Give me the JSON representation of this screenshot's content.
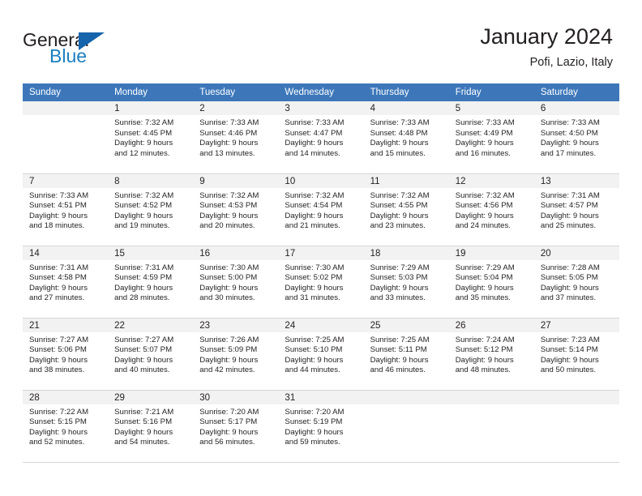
{
  "brand": {
    "name_part1": "General",
    "name_part2": "Blue",
    "triangle_color": "#1664ab",
    "blue_text_color": "#1a7fc1"
  },
  "header": {
    "month_title": "January 2024",
    "location": "Pofi, Lazio, Italy",
    "header_bg_color": "#3d77ba",
    "daynum_band_color": "#f2f2f2"
  },
  "weekday_headers": [
    "Sunday",
    "Monday",
    "Tuesday",
    "Wednesday",
    "Thursday",
    "Friday",
    "Saturday"
  ],
  "weeks": [
    [
      {
        "day": "",
        "sunrise": "",
        "sunset": "",
        "daylight_line1": "",
        "daylight_line2": ""
      },
      {
        "day": "1",
        "sunrise": "Sunrise: 7:32 AM",
        "sunset": "Sunset: 4:45 PM",
        "daylight_line1": "Daylight: 9 hours",
        "daylight_line2": "and 12 minutes."
      },
      {
        "day": "2",
        "sunrise": "Sunrise: 7:33 AM",
        "sunset": "Sunset: 4:46 PM",
        "daylight_line1": "Daylight: 9 hours",
        "daylight_line2": "and 13 minutes."
      },
      {
        "day": "3",
        "sunrise": "Sunrise: 7:33 AM",
        "sunset": "Sunset: 4:47 PM",
        "daylight_line1": "Daylight: 9 hours",
        "daylight_line2": "and 14 minutes."
      },
      {
        "day": "4",
        "sunrise": "Sunrise: 7:33 AM",
        "sunset": "Sunset: 4:48 PM",
        "daylight_line1": "Daylight: 9 hours",
        "daylight_line2": "and 15 minutes."
      },
      {
        "day": "5",
        "sunrise": "Sunrise: 7:33 AM",
        "sunset": "Sunset: 4:49 PM",
        "daylight_line1": "Daylight: 9 hours",
        "daylight_line2": "and 16 minutes."
      },
      {
        "day": "6",
        "sunrise": "Sunrise: 7:33 AM",
        "sunset": "Sunset: 4:50 PM",
        "daylight_line1": "Daylight: 9 hours",
        "daylight_line2": "and 17 minutes."
      }
    ],
    [
      {
        "day": "7",
        "sunrise": "Sunrise: 7:33 AM",
        "sunset": "Sunset: 4:51 PM",
        "daylight_line1": "Daylight: 9 hours",
        "daylight_line2": "and 18 minutes."
      },
      {
        "day": "8",
        "sunrise": "Sunrise: 7:32 AM",
        "sunset": "Sunset: 4:52 PM",
        "daylight_line1": "Daylight: 9 hours",
        "daylight_line2": "and 19 minutes."
      },
      {
        "day": "9",
        "sunrise": "Sunrise: 7:32 AM",
        "sunset": "Sunset: 4:53 PM",
        "daylight_line1": "Daylight: 9 hours",
        "daylight_line2": "and 20 minutes."
      },
      {
        "day": "10",
        "sunrise": "Sunrise: 7:32 AM",
        "sunset": "Sunset: 4:54 PM",
        "daylight_line1": "Daylight: 9 hours",
        "daylight_line2": "and 21 minutes."
      },
      {
        "day": "11",
        "sunrise": "Sunrise: 7:32 AM",
        "sunset": "Sunset: 4:55 PM",
        "daylight_line1": "Daylight: 9 hours",
        "daylight_line2": "and 23 minutes."
      },
      {
        "day": "12",
        "sunrise": "Sunrise: 7:32 AM",
        "sunset": "Sunset: 4:56 PM",
        "daylight_line1": "Daylight: 9 hours",
        "daylight_line2": "and 24 minutes."
      },
      {
        "day": "13",
        "sunrise": "Sunrise: 7:31 AM",
        "sunset": "Sunset: 4:57 PM",
        "daylight_line1": "Daylight: 9 hours",
        "daylight_line2": "and 25 minutes."
      }
    ],
    [
      {
        "day": "14",
        "sunrise": "Sunrise: 7:31 AM",
        "sunset": "Sunset: 4:58 PM",
        "daylight_line1": "Daylight: 9 hours",
        "daylight_line2": "and 27 minutes."
      },
      {
        "day": "15",
        "sunrise": "Sunrise: 7:31 AM",
        "sunset": "Sunset: 4:59 PM",
        "daylight_line1": "Daylight: 9 hours",
        "daylight_line2": "and 28 minutes."
      },
      {
        "day": "16",
        "sunrise": "Sunrise: 7:30 AM",
        "sunset": "Sunset: 5:00 PM",
        "daylight_line1": "Daylight: 9 hours",
        "daylight_line2": "and 30 minutes."
      },
      {
        "day": "17",
        "sunrise": "Sunrise: 7:30 AM",
        "sunset": "Sunset: 5:02 PM",
        "daylight_line1": "Daylight: 9 hours",
        "daylight_line2": "and 31 minutes."
      },
      {
        "day": "18",
        "sunrise": "Sunrise: 7:29 AM",
        "sunset": "Sunset: 5:03 PM",
        "daylight_line1": "Daylight: 9 hours",
        "daylight_line2": "and 33 minutes."
      },
      {
        "day": "19",
        "sunrise": "Sunrise: 7:29 AM",
        "sunset": "Sunset: 5:04 PM",
        "daylight_line1": "Daylight: 9 hours",
        "daylight_line2": "and 35 minutes."
      },
      {
        "day": "20",
        "sunrise": "Sunrise: 7:28 AM",
        "sunset": "Sunset: 5:05 PM",
        "daylight_line1": "Daylight: 9 hours",
        "daylight_line2": "and 37 minutes."
      }
    ],
    [
      {
        "day": "21",
        "sunrise": "Sunrise: 7:27 AM",
        "sunset": "Sunset: 5:06 PM",
        "daylight_line1": "Daylight: 9 hours",
        "daylight_line2": "and 38 minutes."
      },
      {
        "day": "22",
        "sunrise": "Sunrise: 7:27 AM",
        "sunset": "Sunset: 5:07 PM",
        "daylight_line1": "Daylight: 9 hours",
        "daylight_line2": "and 40 minutes."
      },
      {
        "day": "23",
        "sunrise": "Sunrise: 7:26 AM",
        "sunset": "Sunset: 5:09 PM",
        "daylight_line1": "Daylight: 9 hours",
        "daylight_line2": "and 42 minutes."
      },
      {
        "day": "24",
        "sunrise": "Sunrise: 7:25 AM",
        "sunset": "Sunset: 5:10 PM",
        "daylight_line1": "Daylight: 9 hours",
        "daylight_line2": "and 44 minutes."
      },
      {
        "day": "25",
        "sunrise": "Sunrise: 7:25 AM",
        "sunset": "Sunset: 5:11 PM",
        "daylight_line1": "Daylight: 9 hours",
        "daylight_line2": "and 46 minutes."
      },
      {
        "day": "26",
        "sunrise": "Sunrise: 7:24 AM",
        "sunset": "Sunset: 5:12 PM",
        "daylight_line1": "Daylight: 9 hours",
        "daylight_line2": "and 48 minutes."
      },
      {
        "day": "27",
        "sunrise": "Sunrise: 7:23 AM",
        "sunset": "Sunset: 5:14 PM",
        "daylight_line1": "Daylight: 9 hours",
        "daylight_line2": "and 50 minutes."
      }
    ],
    [
      {
        "day": "28",
        "sunrise": "Sunrise: 7:22 AM",
        "sunset": "Sunset: 5:15 PM",
        "daylight_line1": "Daylight: 9 hours",
        "daylight_line2": "and 52 minutes."
      },
      {
        "day": "29",
        "sunrise": "Sunrise: 7:21 AM",
        "sunset": "Sunset: 5:16 PM",
        "daylight_line1": "Daylight: 9 hours",
        "daylight_line2": "and 54 minutes."
      },
      {
        "day": "30",
        "sunrise": "Sunrise: 7:20 AM",
        "sunset": "Sunset: 5:17 PM",
        "daylight_line1": "Daylight: 9 hours",
        "daylight_line2": "and 56 minutes."
      },
      {
        "day": "31",
        "sunrise": "Sunrise: 7:20 AM",
        "sunset": "Sunset: 5:19 PM",
        "daylight_line1": "Daylight: 9 hours",
        "daylight_line2": "and 59 minutes."
      },
      {
        "day": "",
        "sunrise": "",
        "sunset": "",
        "daylight_line1": "",
        "daylight_line2": ""
      },
      {
        "day": "",
        "sunrise": "",
        "sunset": "",
        "daylight_line1": "",
        "daylight_line2": ""
      },
      {
        "day": "",
        "sunrise": "",
        "sunset": "",
        "daylight_line1": "",
        "daylight_line2": ""
      }
    ]
  ]
}
